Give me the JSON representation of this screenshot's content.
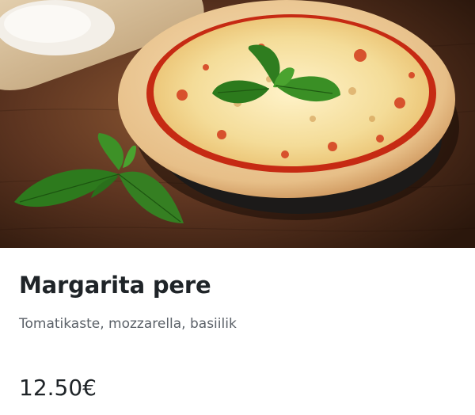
{
  "hero": {
    "image_icon": "margherita-pizza-photo"
  },
  "item": {
    "title": "Margarita pere",
    "description": "Tomatikaste, mozzarella, basiilik",
    "price": "12.50€"
  },
  "colors": {
    "title_text": "#1f2428",
    "description_text": "#5b6168",
    "price_text": "#1f2428",
    "background": "#ffffff"
  }
}
